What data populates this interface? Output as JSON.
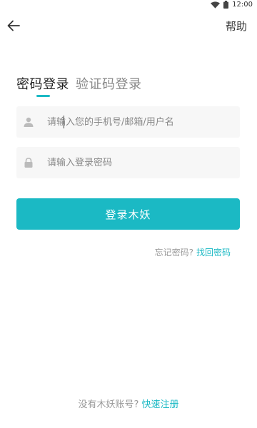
{
  "status_bar": {
    "time": "12:00",
    "icons": [
      "wifi-icon",
      "battery-icon"
    ]
  },
  "header": {
    "back_icon": "arrow-left-icon",
    "help_label": "帮助"
  },
  "tabs": [
    {
      "label": "密码登录",
      "active": true
    },
    {
      "label": "验证码登录",
      "active": false
    }
  ],
  "form": {
    "username": {
      "icon": "user-icon",
      "placeholder": "请输入您的手机号/邮箱/用户名",
      "value": ""
    },
    "password": {
      "icon": "lock-icon",
      "placeholder": "请输入登录密码",
      "value": ""
    },
    "submit_label": "登录木妖"
  },
  "forgot": {
    "question": "忘记密码?",
    "link": "找回密码"
  },
  "register": {
    "question": "没有木妖账号?",
    "link": "快速注册"
  },
  "colors": {
    "accent": "#1bb9c4",
    "field_bg": "#f7f7f7",
    "muted_text": "#999999"
  }
}
